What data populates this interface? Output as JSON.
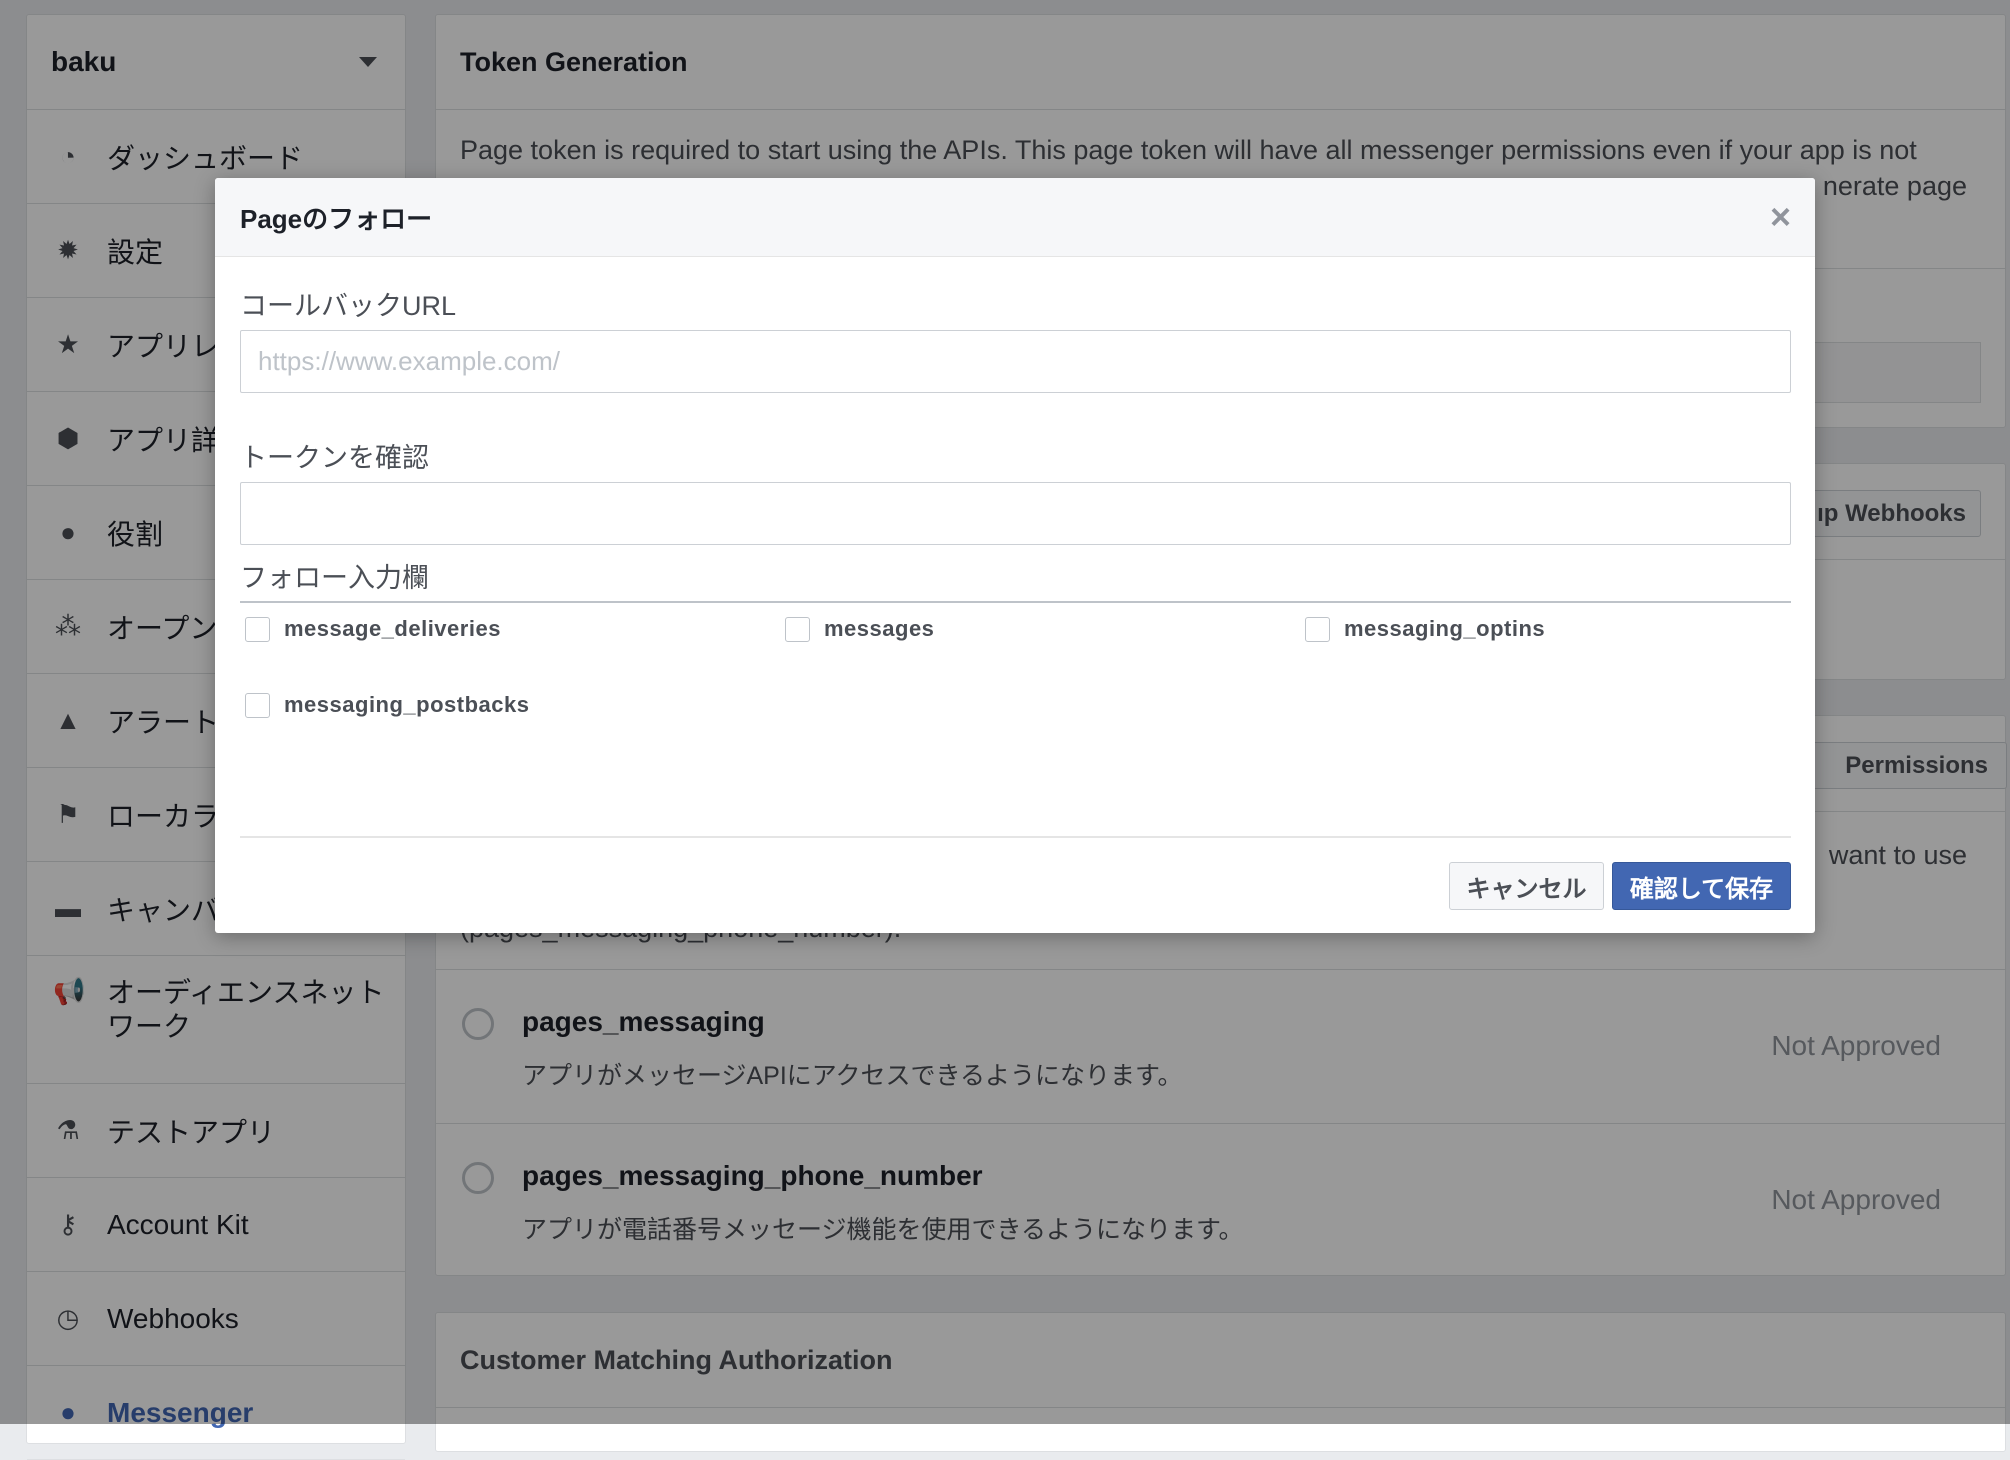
{
  "sidebar": {
    "app_name": "baku",
    "items": [
      {
        "label": "ダッシュボード",
        "icon": "dashboard-icon"
      },
      {
        "label": "設定",
        "icon": "gear-icon"
      },
      {
        "label": "アプリレビュー",
        "icon": "star-icon"
      },
      {
        "label": "アプリ詳細",
        "icon": "box-icon"
      },
      {
        "label": "役割",
        "icon": "person-icon"
      },
      {
        "label": "オープングラフ",
        "icon": "graph-icon"
      },
      {
        "label": "アラート",
        "icon": "warning-icon"
      },
      {
        "label": "ローカライズ",
        "icon": "flag-icon"
      },
      {
        "label": "キャンバス",
        "icon": "card-icon"
      },
      {
        "label": "オーディエンスネットワーク",
        "icon": "megaphone-icon"
      },
      {
        "label": "テストアプリ",
        "icon": "flask-icon"
      },
      {
        "label": "Account Kit",
        "icon": "key-icon"
      },
      {
        "label": "Webhooks",
        "icon": "clock-icon"
      },
      {
        "label": "Messenger",
        "icon": "messenger-icon"
      }
    ]
  },
  "main": {
    "token": {
      "title": "Token Generation",
      "text1": "Page token is required to start using the APIs. This page token will have all messenger permissions even if your app is not",
      "text2": "nerate page"
    },
    "webhooks_button": "ıp Webhooks",
    "permissions_button": "Permissions",
    "perm_text1": "want to use",
    "perm_text2": "(pages_messaging_phone_number).",
    "permissions": [
      {
        "name": "pages_messaging",
        "desc": "アプリがメッセージAPIにアクセスできるようになります。",
        "status": "Not Approved"
      },
      {
        "name": "pages_messaging_phone_number",
        "desc": "アプリが電話番号メッセージ機能を使用できるようになります。",
        "status": "Not Approved"
      }
    ],
    "customer_matching": "Customer Matching Authorization"
  },
  "modal": {
    "title": "Pageのフォロー",
    "close": "×",
    "callback_label": "コールバックURL",
    "callback_placeholder": "https://www.example.com/",
    "callback_value": "",
    "verify_label": "トークンを確認",
    "verify_value": "",
    "fields_label": "フォロー入力欄",
    "fields": [
      {
        "label": "message_deliveries",
        "checked": false
      },
      {
        "label": "messages",
        "checked": false
      },
      {
        "label": "messaging_optins",
        "checked": false
      },
      {
        "label": "messaging_postbacks",
        "checked": false
      }
    ],
    "cancel": "キャンセル",
    "save": "確認して保存"
  },
  "colors": {
    "primary": "#4267b2",
    "link": "#4267b2"
  }
}
